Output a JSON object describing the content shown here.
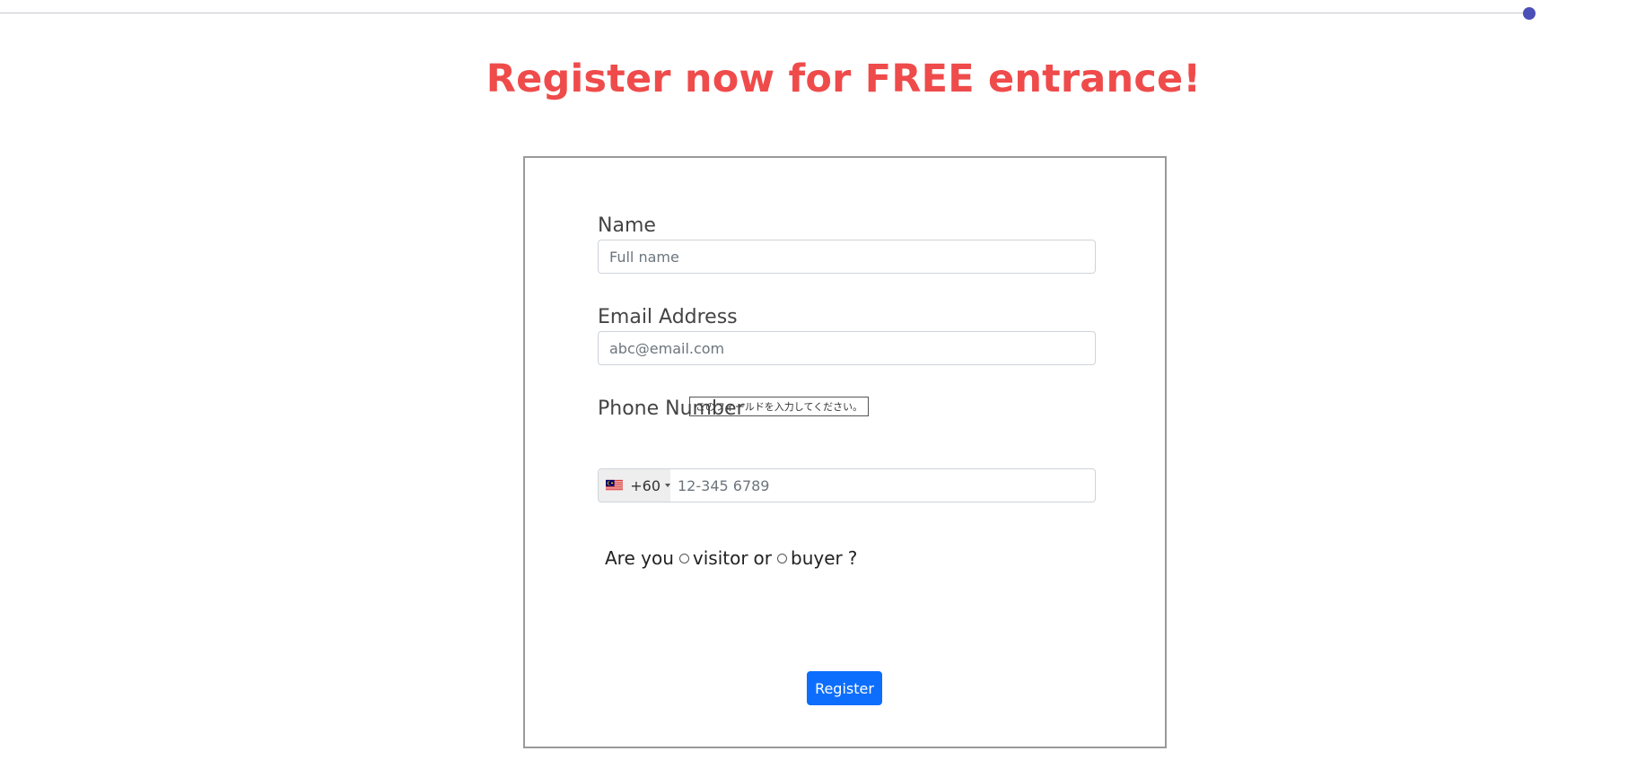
{
  "headline": "Register now for FREE entrance!",
  "form": {
    "name": {
      "label": "Name",
      "placeholder": "Full name",
      "value": ""
    },
    "email": {
      "label": "Email Address",
      "placeholder": "abc@email.com",
      "value": "",
      "validation_tooltip": "このフィールドを入力してください。"
    },
    "phone": {
      "label": "Phone Number",
      "country_flag": "malaysia-flag-icon",
      "dial_code": "+60",
      "placeholder": "12-345 6789",
      "value": ""
    },
    "role": {
      "prefix": "Are you",
      "option_visitor": "visitor",
      "connector": "or",
      "option_buyer": "buyer",
      "suffix": "?"
    },
    "submit_label": "Register"
  },
  "colors": {
    "headline": "#ef4b4b",
    "button": "#0d6efd",
    "progress_dot": "#4b4fb8"
  }
}
